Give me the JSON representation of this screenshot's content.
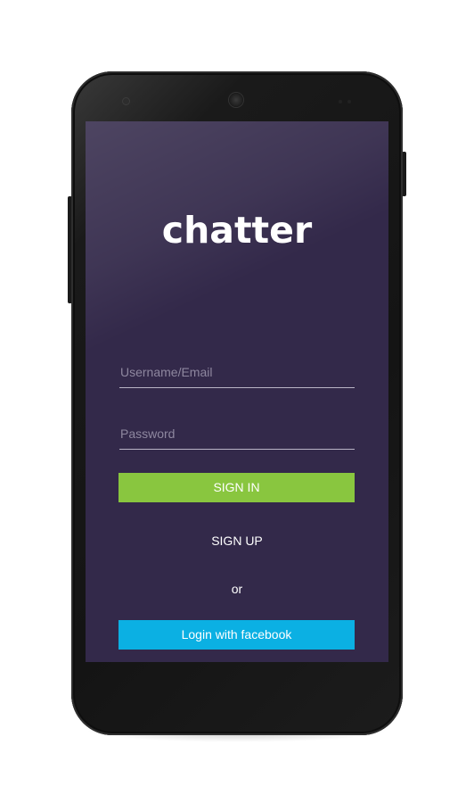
{
  "app": {
    "logo_text": "chatter"
  },
  "login_form": {
    "username_placeholder": "Username/Email",
    "password_placeholder": "Password",
    "username_value": "",
    "password_value": ""
  },
  "actions": {
    "sign_in_label": "SIGN IN",
    "sign_up_label": "SIGN UP",
    "or_text": "or",
    "facebook_label": "Login with facebook"
  },
  "theme": {
    "background": "#33294a",
    "sign_in_color": "#89c63f",
    "facebook_color": "#0bb0e3",
    "text_color": "#ffffff"
  }
}
